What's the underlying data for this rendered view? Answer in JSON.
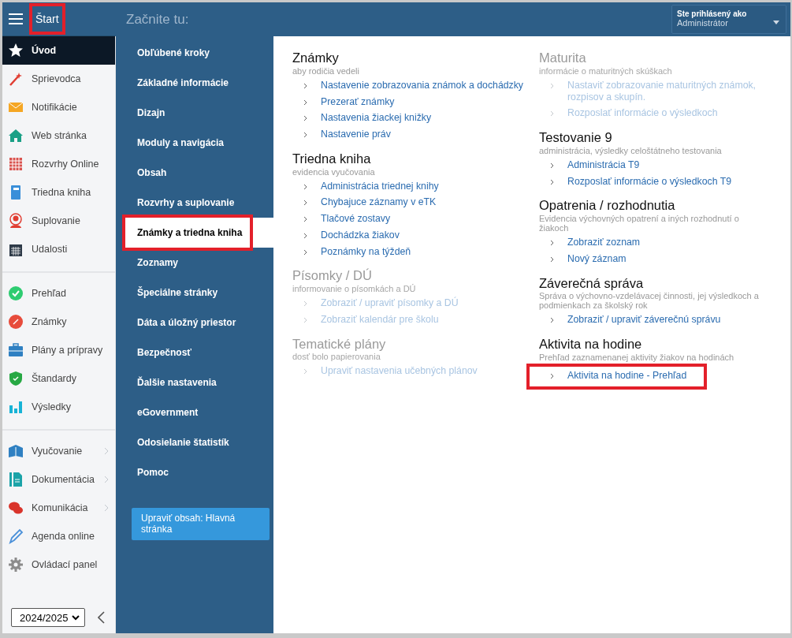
{
  "header": {
    "menu_label": "Štart",
    "menu_highlighted": true,
    "title": "Začnite tu:",
    "user": {
      "label": "Ste prihlásený ako",
      "name": "Administrátor"
    }
  },
  "sidebar": {
    "groups": [
      [
        {
          "label": "Úvod",
          "selected": true,
          "has_submenu": false
        },
        {
          "label": "Sprievodca",
          "selected": false,
          "has_submenu": false
        },
        {
          "label": "Notifikácie",
          "selected": false,
          "has_submenu": false
        },
        {
          "label": "Web stránka",
          "selected": false,
          "has_submenu": false
        },
        {
          "label": "Rozvrhy Online",
          "selected": false,
          "has_submenu": false
        },
        {
          "label": "Triedna kniha",
          "selected": false,
          "has_submenu": false
        },
        {
          "label": "Suplovanie",
          "selected": false,
          "has_submenu": false
        },
        {
          "label": "Udalosti",
          "selected": false,
          "has_submenu": false
        }
      ],
      [
        {
          "label": "Prehľad",
          "selected": false,
          "has_submenu": false
        },
        {
          "label": "Známky",
          "selected": false,
          "has_submenu": false
        },
        {
          "label": "Plány a prípravy",
          "selected": false,
          "has_submenu": false
        },
        {
          "label": "Štandardy",
          "selected": false,
          "has_submenu": false
        },
        {
          "label": "Výsledky",
          "selected": false,
          "has_submenu": false
        }
      ],
      [
        {
          "label": "Vyučovanie",
          "selected": false,
          "has_submenu": true
        },
        {
          "label": "Dokumentácia",
          "selected": false,
          "has_submenu": true
        },
        {
          "label": "Komunikácia",
          "selected": false,
          "has_submenu": true
        },
        {
          "label": "Agenda online",
          "selected": false,
          "has_submenu": false
        },
        {
          "label": "Ovládací panel",
          "selected": false,
          "has_submenu": false
        }
      ]
    ],
    "year_select": {
      "value": "2024/2025"
    }
  },
  "menu": {
    "items": [
      {
        "label": "Obľúbené kroky",
        "selected": false,
        "highlighted": false
      },
      {
        "label": "Základné informácie",
        "selected": false,
        "highlighted": false
      },
      {
        "label": "Dizajn",
        "selected": false,
        "highlighted": false
      },
      {
        "label": "Moduly a navigácia",
        "selected": false,
        "highlighted": false
      },
      {
        "label": "Obsah",
        "selected": false,
        "highlighted": false
      },
      {
        "label": "Rozvrhy a suplovanie",
        "selected": false,
        "highlighted": false
      },
      {
        "label": "Známky a triedna kniha",
        "selected": true,
        "highlighted": true
      },
      {
        "label": "Zoznamy",
        "selected": false,
        "highlighted": false
      },
      {
        "label": "Špeciálne stránky",
        "selected": false,
        "highlighted": false
      },
      {
        "label": "Dáta a úložný priestor",
        "selected": false,
        "highlighted": false
      },
      {
        "label": "Bezpečnosť",
        "selected": false,
        "highlighted": false
      },
      {
        "label": "Ďalšie nastavenia",
        "selected": false,
        "highlighted": false
      },
      {
        "label": "eGovernment",
        "selected": false,
        "highlighted": false
      },
      {
        "label": "Odosielanie štatistík",
        "selected": false,
        "highlighted": false
      },
      {
        "label": "Pomoc",
        "selected": false,
        "highlighted": false
      }
    ],
    "edit_button": "Upraviť obsah: Hlavná stránka"
  },
  "content": {
    "columns": [
      [
        {
          "title": "Známky",
          "subtitle": "aby rodičia vedeli",
          "disabled": false,
          "links": [
            {
              "label": "Nastavenie zobrazovania známok a dochádzky",
              "highlighted": false
            },
            {
              "label": "Prezerať známky",
              "highlighted": false
            },
            {
              "label": "Nastavenia žiackej knižky",
              "highlighted": false
            },
            {
              "label": "Nastavenie práv",
              "highlighted": false
            }
          ]
        },
        {
          "title": "Triedna kniha",
          "subtitle": "evidencia vyučovania",
          "disabled": false,
          "links": [
            {
              "label": "Administrácia triednej knihy",
              "highlighted": false
            },
            {
              "label": "Chybajuce záznamy v eTK",
              "highlighted": false
            },
            {
              "label": "Tlačové zostavy",
              "highlighted": false
            },
            {
              "label": "Dochádzka žiakov",
              "highlighted": false
            },
            {
              "label": "Poznámky na týždeň",
              "highlighted": false
            }
          ]
        },
        {
          "title": "Písomky / DÚ",
          "subtitle": "informovanie o písomkách a DÚ",
          "disabled": true,
          "links": [
            {
              "label": "Zobraziť / upraviť písomky a DÚ",
              "highlighted": false
            },
            {
              "label": "Zobraziť kalendár pre školu",
              "highlighted": false
            }
          ]
        },
        {
          "title": "Tematické plány",
          "subtitle": "dosť bolo papierovania",
          "disabled": true,
          "links": [
            {
              "label": "Upraviť nastavenia učebných plánov",
              "highlighted": false
            }
          ]
        }
      ],
      [
        {
          "title": "Maturita",
          "subtitle": "informácie o maturitných skúškach",
          "disabled": true,
          "links": [
            {
              "label": "Nastaviť zobrazovanie maturitných známok, rozpisov a skupín.",
              "highlighted": false
            },
            {
              "label": "Rozposlať informácie o výsledkoch",
              "highlighted": false
            }
          ]
        },
        {
          "title": "Testovanie 9",
          "subtitle": "administrácia, výsledky celoštátneho testovania",
          "disabled": false,
          "links": [
            {
              "label": "Administrácia T9",
              "highlighted": false
            },
            {
              "label": "Rozposlať informácie o výsledkoch T9",
              "highlighted": false
            }
          ]
        },
        {
          "title": "Opatrenia / rozhodnutia",
          "subtitle": "Evidencia výchovných opatrení a iných rozhodnutí o žiakoch",
          "disabled": false,
          "links": [
            {
              "label": "Zobraziť zoznam",
              "highlighted": false
            },
            {
              "label": "Nový záznam",
              "highlighted": false
            }
          ]
        },
        {
          "title": "Záverečná správa",
          "subtitle": "Správa o výchovno-vzdelávacej činnosti, jej výsledkoch a podmienkach za školský rok",
          "disabled": false,
          "links": [
            {
              "label": "Zobraziť / upraviť záverečnú správu",
              "highlighted": false
            }
          ]
        },
        {
          "title": "Aktivita na hodine",
          "subtitle": "Prehľad zaznamenanej aktivity žiakov na hodinách",
          "disabled": false,
          "links": [
            {
              "label": "Aktivita na hodine - Prehľad",
              "highlighted": true
            }
          ]
        }
      ]
    ]
  }
}
